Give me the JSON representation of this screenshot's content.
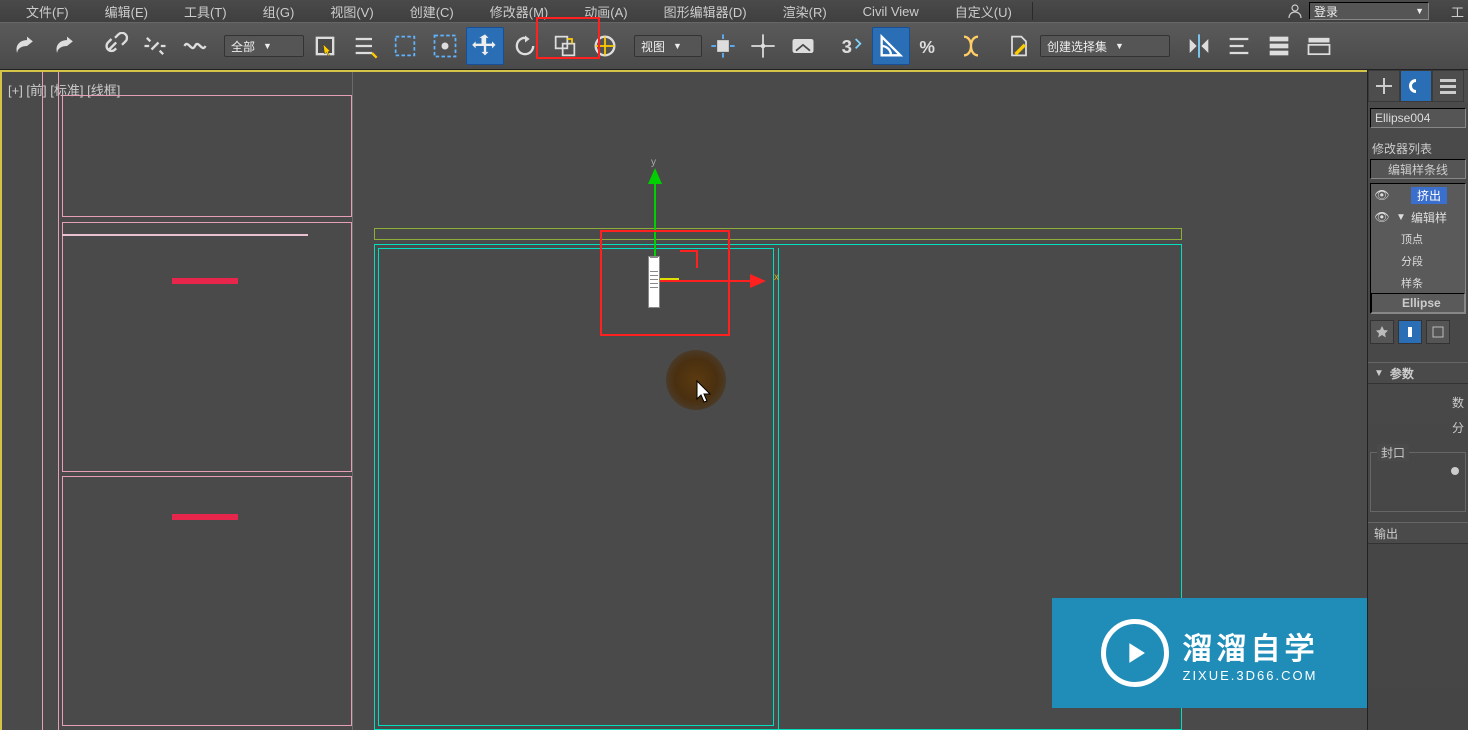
{
  "menubar": {
    "items": [
      "文件(F)",
      "编辑(E)",
      "工具(T)",
      "组(G)",
      "视图(V)",
      "创建(C)",
      "修改器(M)",
      "动画(A)",
      "图形编辑器(D)",
      "渲染(R)",
      "Civil View",
      "自定义(U)",
      "工"
    ],
    "login_label": "登录"
  },
  "toolbar": {
    "filter_dropdown": "全部",
    "coord_dropdown": "视图",
    "named_selection": "创建选择集"
  },
  "viewport": {
    "label": "[+] [前] [标准] [线框]",
    "axis_y": "y",
    "axis_x": "x"
  },
  "cmdpanel": {
    "object_name": "Ellipse004",
    "modlist_label": "修改器列表",
    "modlist_select": "编辑样条线",
    "stack": {
      "item0": "挤出",
      "item1": "编辑样",
      "sub0": "顶点",
      "sub1": "分段",
      "sub2": "样条",
      "base": "Ellipse"
    },
    "rollout_params": "参数",
    "rollout_cap": "封口",
    "rollout_output": "输出",
    "params_row0": "数",
    "params_row1": "分"
  },
  "watermark": {
    "title": "溜溜自学",
    "url": "ZIXUE.3D66.COM"
  }
}
